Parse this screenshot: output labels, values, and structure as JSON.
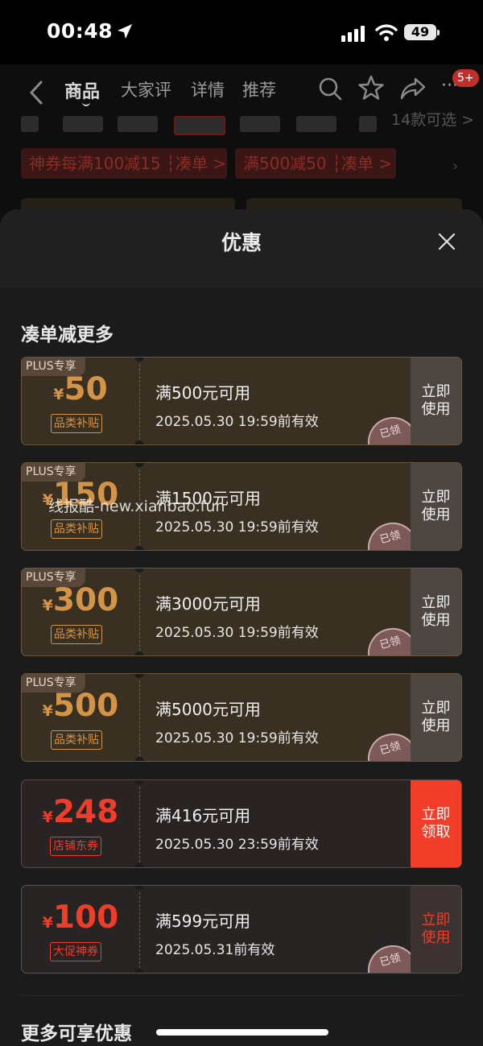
{
  "status_bar": {
    "time": "00:48",
    "battery": "49"
  },
  "nav": {
    "tabs": [
      "商品",
      "大家评",
      "详情",
      "推荐"
    ],
    "badge": "5+"
  },
  "background": {
    "colors_count": "14款可选 >",
    "coupons": [
      "神券每满100减15 ┆凑单 >",
      "满500减50 ┆凑单 >"
    ]
  },
  "sheet": {
    "title": "优惠",
    "section_title": "凑单减更多",
    "more_title": "更多可享优惠"
  },
  "watermark": "线报酷-new.xianbao.fun",
  "coupons": [
    {
      "type": "plus",
      "tag": "PLUS专享",
      "currency": "¥",
      "amount": "50",
      "category": "品类补贴",
      "condition": "满500元可用",
      "validity": "2025.05.30 19:59前有效",
      "action": "立即使用",
      "stamp": "已领"
    },
    {
      "type": "plus",
      "tag": "PLUS专享",
      "currency": "¥",
      "amount": "150",
      "category": "品类补贴",
      "condition": "满1500元可用",
      "validity": "2025.05.30 19:59前有效",
      "action": "立即使用",
      "stamp": "已领"
    },
    {
      "type": "plus",
      "tag": "PLUS专享",
      "currency": "¥",
      "amount": "300",
      "category": "品类补贴",
      "condition": "满3000元可用",
      "validity": "2025.05.30 19:59前有效",
      "action": "立即使用",
      "stamp": "已领"
    },
    {
      "type": "plus",
      "tag": "PLUS专享",
      "currency": "¥",
      "amount": "500",
      "category": "品类补贴",
      "condition": "满5000元可用",
      "validity": "2025.05.30 19:59前有效",
      "action": "立即使用",
      "stamp": "已领"
    },
    {
      "type": "shop",
      "tag": "",
      "currency": "¥",
      "amount": "248",
      "category": "店铺东券",
      "condition": "满416元可用",
      "validity": "2025.05.30 23:59前有效",
      "action": "立即领取",
      "stamp": ""
    },
    {
      "type": "promo",
      "tag": "",
      "currency": "¥",
      "amount": "100",
      "category": "大促神券",
      "condition": "满599元可用",
      "validity": "2025.05.31前有效",
      "action": "立即使用",
      "stamp": "已领"
    }
  ]
}
